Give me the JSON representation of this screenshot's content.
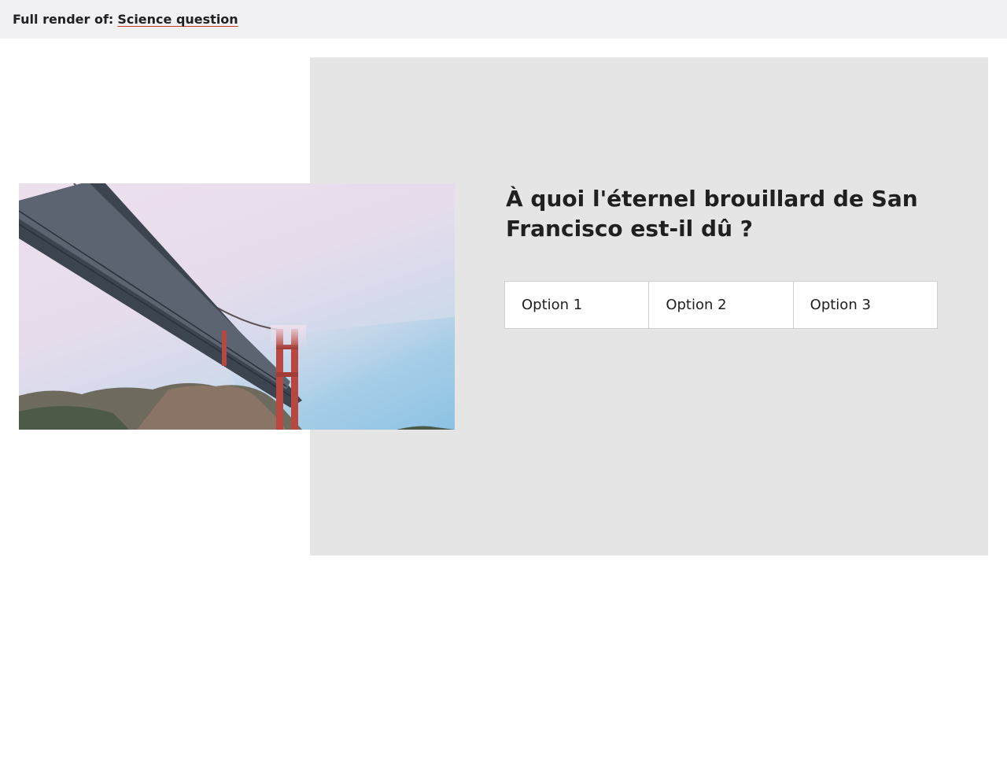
{
  "header": {
    "prefix": "Full render of:",
    "link_label": "Science question"
  },
  "question": {
    "text": "À quoi l'éternel brouillard de San Francisco est-il dû ?",
    "options": [
      "Option 1",
      "Option 2",
      "Option 3"
    ]
  },
  "image": {
    "subject": "golden-gate-bridge-in-fog"
  },
  "colors": {
    "header_bg": "#f1f1f3",
    "panel_bg": "#e5e5e5",
    "text": "#202020",
    "link_underline": "#c0392b"
  }
}
